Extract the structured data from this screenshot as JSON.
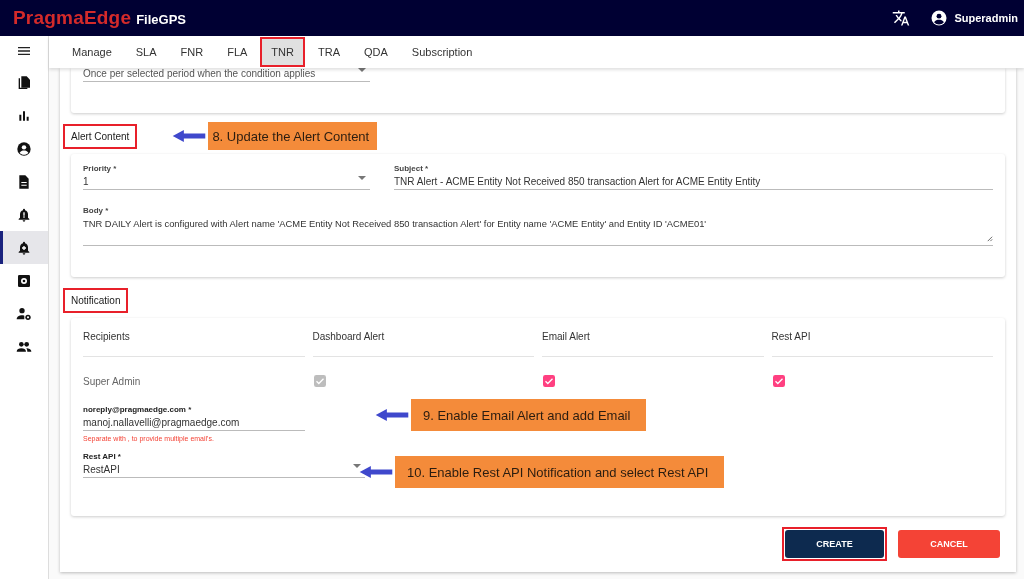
{
  "header": {
    "brand": "PragmaEdge",
    "product": "FileGPS",
    "user": "Superadmin"
  },
  "sidebar": {
    "items": [
      {
        "selected": false
      },
      {
        "selected": false
      },
      {
        "selected": false
      },
      {
        "selected": false
      },
      {
        "selected": false
      },
      {
        "selected": true
      },
      {
        "selected": false
      },
      {
        "selected": false
      },
      {
        "selected": false
      }
    ]
  },
  "tabs": [
    {
      "label": "Manage",
      "selected": false,
      "highlighted": false
    },
    {
      "label": "SLA",
      "selected": false,
      "highlighted": false
    },
    {
      "label": "FNR",
      "selected": false,
      "highlighted": false
    },
    {
      "label": "FLA",
      "selected": false,
      "highlighted": false
    },
    {
      "label": "TNR",
      "selected": true,
      "highlighted": true
    },
    {
      "label": "TRA",
      "selected": false,
      "highlighted": false
    },
    {
      "label": "QDA",
      "selected": false,
      "highlighted": false
    },
    {
      "label": "Subscription",
      "selected": false,
      "highlighted": false
    }
  ],
  "frequency": {
    "value": "Once per selected period when the condition applies"
  },
  "alert_content": {
    "title": "Alert Content",
    "highlighted": true,
    "callout": "8. Update the Alert Content",
    "priority": {
      "label": "Priority *",
      "value": "1"
    },
    "subject": {
      "label": "Subject *",
      "value": "TNR Alert - ACME Entity Not Received 850 transaction Alert for ACME Entity Entity"
    },
    "body": {
      "label": "Body *",
      "value": "TNR DAILY Alert is configured with Alert name 'ACME Entity Not Received 850 transaction Alert' for Entity name 'ACME Entity' and Entity ID 'ACME01'"
    }
  },
  "notification": {
    "title": "Notification",
    "highlighted": true,
    "columns": [
      "Recipients",
      "Dashboard Alert",
      "Email Alert",
      "Rest API"
    ],
    "rows": [
      {
        "name": "Super Admin",
        "checks": [
          {
            "checked": true,
            "disabled": true
          },
          {
            "checked": true,
            "disabled": false
          },
          {
            "checked": true,
            "disabled": false
          }
        ]
      }
    ],
    "email": {
      "label": "noreply@pragmaedge.com *",
      "value": "manoj.nallavelli@pragmaedge.com",
      "helper_text": "Separate with , to provide multiple email's.",
      "callout": "9. Enable Email Alert and add Email"
    },
    "rest_api": {
      "label": "Rest API *",
      "value": "RestAPI",
      "callout": "10. Enable Rest API Notification and select Rest API"
    }
  },
  "buttons": [
    {
      "label": "CREATE",
      "kind": "primary",
      "highlighted": true
    },
    {
      "label": "CANCEL",
      "kind": "danger",
      "highlighted": false
    }
  ]
}
